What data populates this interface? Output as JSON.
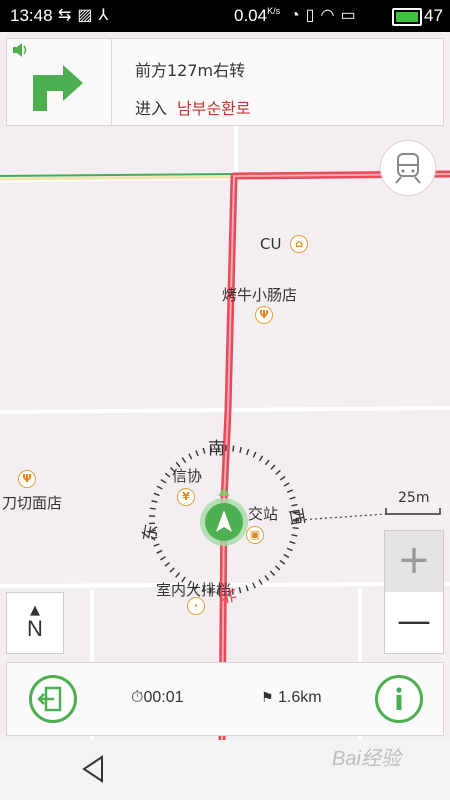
{
  "status_bar": {
    "time": "13:48",
    "icons_left": [
      "usb-icon",
      "image-icon",
      "usb-tether-icon"
    ],
    "net_speed": "0.04",
    "net_speed_unit": "K/s",
    "icons_right": [
      "nfc-icon",
      "vibrate-icon",
      "wifi-icon",
      "screen-icon"
    ],
    "battery_level": "47"
  },
  "navigation": {
    "instruction": "前方127m右转",
    "enter_label": "进入",
    "road_name": "남부순환로",
    "turn_direction": "right",
    "voice_icon": "speaker-icon"
  },
  "map": {
    "pois": [
      {
        "name": "CU",
        "icon": "shopping-basket-icon"
      },
      {
        "name": "烤牛小肠店",
        "icon": "fork-knife-icon"
      },
      {
        "name": "刀切面店",
        "icon": "fork-knife-icon"
      },
      {
        "name": "信协",
        "icon": "yen-icon"
      },
      {
        "name": "交站",
        "icon": "bus-icon"
      },
      {
        "name": "室内大排档",
        "icon": "dot-icon"
      }
    ],
    "compass": {
      "south": "南",
      "east": "东",
      "west": "西",
      "north": "北"
    },
    "scale_label": "25m",
    "zoom_in_label": "+",
    "zoom_out_label": "—",
    "north_label": "N",
    "north_arrow": "▲"
  },
  "bottom_bar": {
    "elapsed_time": "00:01",
    "remaining_distance": "1.6km"
  },
  "watermark": "Bai经验",
  "colors": {
    "route": "#e84a5a",
    "accent_green": "#4caf50",
    "road_name": "#c0392b",
    "map_bg": "#f3eef1"
  }
}
